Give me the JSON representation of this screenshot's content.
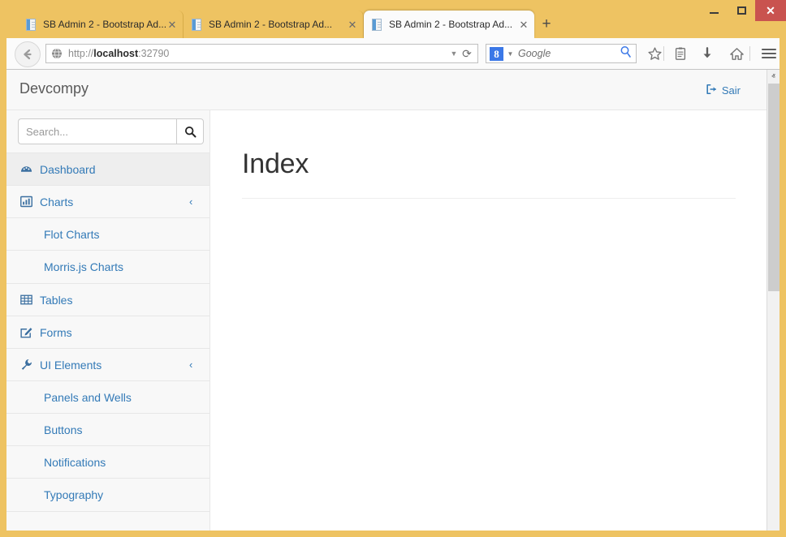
{
  "window": {
    "controls": {
      "minimize": "–",
      "maximize": "☐",
      "close": "✕"
    }
  },
  "browser": {
    "tabs": [
      {
        "title": "SB Admin 2 - Bootstrap Ad...",
        "close": "✕",
        "active": false
      },
      {
        "title": "SB Admin 2 - Bootstrap Ad...",
        "close": "✕",
        "active": false
      },
      {
        "title": "SB Admin 2 - Bootstrap Ad...",
        "close": "✕",
        "active": true
      }
    ],
    "new_tab_label": "+",
    "url": {
      "scheme": "http://",
      "host": "localhost",
      "port": ":32790",
      "full": "http://localhost:32790",
      "dropmarker": "▼",
      "reload": "⟳"
    },
    "search": {
      "engine": "8",
      "engine_name": "Google",
      "placeholder": "Google",
      "dropmarker": "▼"
    },
    "toolbar_icons": [
      "bookmark-star-icon",
      "library-icon",
      "downloads-icon",
      "home-icon",
      "menu-hamburger-icon"
    ]
  },
  "app": {
    "brand": "Devcompy",
    "logout_label": "Sair",
    "sidebar": {
      "search": {
        "placeholder": "Search...",
        "value": "",
        "button_icon": "search-icon"
      },
      "items": [
        {
          "label": "Dashboard",
          "icon": "dashboard-tachometer-icon",
          "active": true,
          "caret": "",
          "children": []
        },
        {
          "label": "Charts",
          "icon": "bar-chart-icon",
          "active": false,
          "caret": "‹",
          "children": [
            "Flot Charts",
            "Morris.js Charts"
          ]
        },
        {
          "label": "Tables",
          "icon": "table-icon",
          "active": false,
          "caret": "",
          "children": []
        },
        {
          "label": "Forms",
          "icon": "edit-pencil-icon",
          "active": false,
          "caret": "",
          "children": []
        },
        {
          "label": "UI Elements",
          "icon": "wrench-icon",
          "active": false,
          "caret": "‹",
          "children": [
            "Panels and Wells",
            "Buttons",
            "Notifications",
            "Typography"
          ]
        }
      ]
    },
    "content": {
      "heading": "Index"
    }
  },
  "scrollbar": {
    "up_arrow": "ⱏ",
    "down_arrow": "ⱟ"
  },
  "colors": {
    "window_frame": "#eec362",
    "tab_active_bg": "#fbfbfb",
    "link_blue": "#337ab7",
    "close_button_red": "#c9534f",
    "sidebar_bg": "#f8f8f8",
    "sidebar_active_bg": "#eeeeee",
    "search_engine_blue": "#3b78e7"
  }
}
